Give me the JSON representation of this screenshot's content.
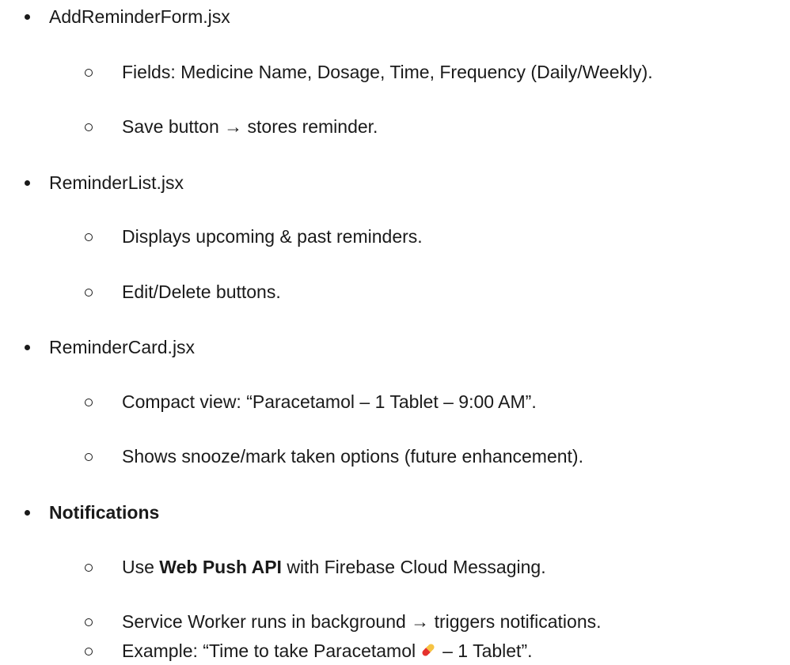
{
  "items": [
    {
      "title": "AddReminderForm.jsx",
      "subs": [
        "Fields: Medicine Name, Dosage, Time, Frequency (Daily/Weekly).",
        "Save button → stores reminder."
      ]
    },
    {
      "title": "ReminderList.jsx",
      "subs": [
        "Displays upcoming & past reminders.",
        "Edit/Delete buttons."
      ]
    },
    {
      "title": "ReminderCard.jsx",
      "subs": [
        "Compact view: “Paracetamol – 1 Tablet – 9:00 AM”.",
        "Shows snooze/mark taken options (future enhancement)."
      ]
    },
    {
      "title": "Notifications",
      "sub1": {
        "pre": "Use ",
        "bold": "Web Push API",
        "post": " with Firebase Cloud Messaging."
      },
      "sub2": "Service Worker runs in background → triggers notifications.",
      "sub3": {
        "pre": "Example: “Time to take Paracetamol",
        "post": "– 1 Tablet”."
      }
    }
  ],
  "icons": {
    "pill": "pill-icon"
  },
  "colors": {
    "text": "#1a1a1a",
    "pill_red": "#e5322d",
    "pill_yellow": "#f6c343"
  }
}
